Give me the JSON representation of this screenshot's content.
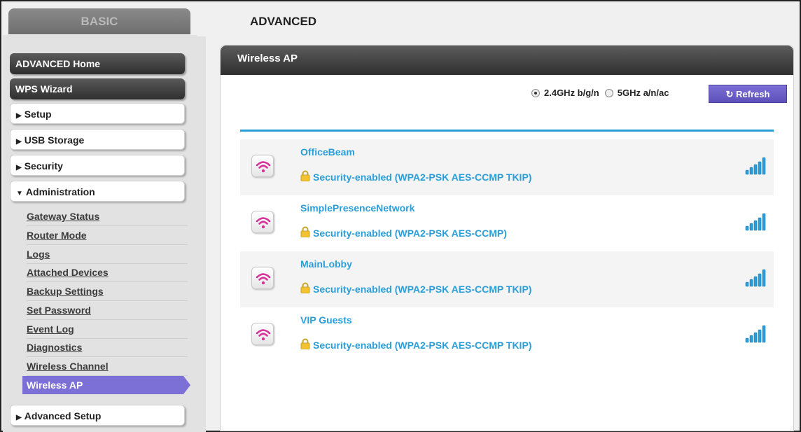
{
  "tabs": {
    "basic": "BASIC",
    "advanced": "ADVANCED"
  },
  "sidebar": {
    "advanced_home": "ADVANCED Home",
    "wps_wizard": "WPS Wizard",
    "setup": "Setup",
    "usb_storage": "USB Storage",
    "security": "Security",
    "administration": "Administration",
    "admin_items": [
      "Gateway Status",
      "Router Mode",
      "Logs",
      "Attached Devices",
      "Backup Settings",
      "Set Password",
      "Event Log",
      "Diagnostics",
      "Wireless Channel"
    ],
    "active_item": "Wireless AP",
    "advanced_setup": "Advanced Setup"
  },
  "panel": {
    "title": "Wireless AP",
    "band_24": "2.4GHz b/g/n",
    "band_5": "5GHz a/n/ac",
    "selected_band": "2.4GHz b/g/n",
    "refresh_label": "Refresh",
    "networks": [
      {
        "ssid": "OfficeBeam",
        "security": "Security-enabled (WPA2-PSK AES-CCMP TKIP)"
      },
      {
        "ssid": "SimplePresenceNetwork",
        "security": "Security-enabled (WPA2-PSK AES-CCMP)"
      },
      {
        "ssid": "MainLobby",
        "security": "Security-enabled (WPA2-PSK AES-CCMP TKIP)"
      },
      {
        "ssid": "VIP Guests",
        "security": "Security-enabled (WPA2-PSK AES-CCMP TKIP)"
      }
    ]
  },
  "colors": {
    "accent": "#2a9ed8",
    "active": "#7c6fd6",
    "wifi": "#d6339c"
  }
}
